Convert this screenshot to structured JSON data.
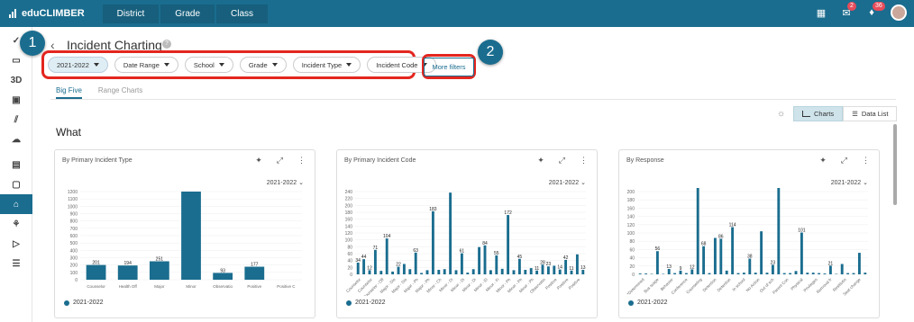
{
  "app": {
    "name": "eduCLIMBER",
    "nav": [
      "District",
      "Grade",
      "Class"
    ],
    "badges": [
      "2",
      "36"
    ]
  },
  "page": {
    "title": "Incident Charting"
  },
  "filters": [
    {
      "label": "2021-2022",
      "selected": true
    },
    {
      "label": "Date Range",
      "selected": false
    },
    {
      "label": "School",
      "selected": false
    },
    {
      "label": "Grade",
      "selected": false
    },
    {
      "label": "Incident Type",
      "selected": false
    },
    {
      "label": "Incident Code",
      "selected": false
    }
  ],
  "more_filters": "More filters",
  "callouts": [
    "1",
    "2"
  ],
  "subtabs": [
    "Big Five",
    "Range Charts"
  ],
  "view_toggle": {
    "charts": "Charts",
    "list": "Data List"
  },
  "section": "What",
  "colors": {
    "brand": "#1a6d8f",
    "bar": "#1a6d8f",
    "callout": "#1a6d8f",
    "highlight": "#e3261f"
  },
  "chart_data": [
    {
      "type": "bar",
      "title": "By Primary Incident Type",
      "year": "2021-2022",
      "ylim": [
        0,
        1200
      ],
      "yticks": [
        0,
        100,
        200,
        300,
        400,
        500,
        600,
        700,
        800,
        900,
        1000,
        1100,
        1200
      ],
      "categories": [
        "Counselor",
        "Health Off",
        "Major",
        "Minor",
        "Observatio",
        "Positive",
        "Positive C"
      ],
      "values": [
        201,
        194,
        251,
        1200,
        93,
        177,
        0
      ],
      "labels": [
        "201",
        "194",
        "251",
        "",
        "93",
        "177",
        ""
      ],
      "legend": "2021-2022"
    },
    {
      "type": "bar",
      "title": "By Primary Incident Code",
      "year": "2021-2022",
      "ylim": [
        0,
        240
      ],
      "yticks": [
        0,
        20,
        40,
        60,
        80,
        100,
        120,
        140,
        160,
        180,
        200,
        220,
        240
      ],
      "categories": [
        "Counselor",
        "Counselor",
        "Counselor - Off",
        "Major - Dis",
        "Major - Dis",
        "Major - Ph",
        "Major - Ph",
        "Minor - Ch",
        "Minor - Di",
        "Minor - Di",
        "Minor - Di",
        "Minor - El",
        "Minor - Fi",
        "Minor - Ph",
        "Minor - Ph",
        "Minor - Ph",
        "Observatio",
        "Positive",
        "Positive",
        "Positive"
      ],
      "values": [
        34,
        44,
        12,
        71,
        10,
        104,
        8,
        22,
        30,
        15,
        63,
        4,
        12,
        183,
        13,
        15,
        237,
        12,
        61,
        5,
        15,
        79,
        84,
        12,
        55,
        16,
        172,
        12,
        45,
        13,
        18,
        11,
        28,
        23,
        25,
        14,
        42,
        11,
        58,
        13
      ],
      "labels": [
        "34",
        "44",
        "12",
        "71",
        "",
        "104",
        "",
        "22",
        "",
        "",
        "63",
        "",
        "",
        "183",
        "",
        "",
        "",
        "",
        "61",
        "",
        "",
        "",
        "84",
        "",
        "55",
        "",
        "172",
        "",
        "45",
        "",
        "",
        "11",
        "28",
        "23",
        "",
        "14",
        "42",
        "11",
        "",
        "13"
      ],
      "legend": "2021-2022"
    },
    {
      "type": "bar",
      "title": "By Response",
      "year": "2021-2022",
      "ylim": [
        0,
        200
      ],
      "yticks": [
        0,
        20,
        40,
        60,
        80,
        100,
        120,
        140,
        160,
        180,
        200
      ],
      "categories": [
        "*Determined",
        "Bus suspe",
        "Behavior",
        "Conference",
        "Counseling",
        "Detention",
        "Detention",
        "In school",
        "No Action",
        "Out of sch",
        "Parent Con",
        "Physical",
        "Privileges",
        "Removal fr",
        "Restitutio",
        "Seat change"
      ],
      "values": [
        2,
        2,
        1,
        56,
        1,
        13,
        3,
        9,
        3,
        12,
        212,
        68,
        3,
        88,
        86,
        9,
        114,
        3,
        4,
        38,
        4,
        104,
        4,
        23,
        212,
        3,
        3,
        8,
        101,
        4,
        4,
        3,
        2,
        21,
        1,
        25,
        3,
        3,
        52,
        4
      ],
      "labels": [
        "",
        "",
        "",
        "56",
        "",
        "13",
        "",
        "9",
        "",
        "12",
        "",
        "68",
        "",
        "",
        "86",
        "",
        "114",
        "",
        "",
        "38",
        "",
        "",
        "",
        "23",
        "",
        "",
        "",
        "",
        "101",
        "",
        "",
        "",
        "",
        "21",
        "",
        "",
        "",
        "",
        "",
        ""
      ],
      "legend": "2021-2022"
    }
  ]
}
